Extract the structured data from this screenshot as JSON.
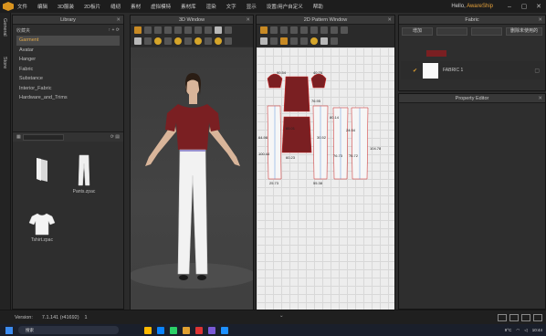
{
  "menu": {
    "items": [
      "文件",
      "编辑",
      "3D服装",
      "2D板片",
      "缝纫",
      "素材",
      "虚拟模特",
      "素材库",
      "渲染",
      "文字",
      "显示",
      "设置/用户自定义",
      "帮助"
    ],
    "greeting": "Hello, ",
    "username": "AwareShip"
  },
  "side_tabs": [
    "General",
    "Store"
  ],
  "library": {
    "title": "Library",
    "toolbar_label": "收藏夹",
    "items": [
      "Garment",
      "Avatar",
      "Hanger",
      "Fabric",
      "Substance",
      "Interior_Fabric",
      "Hardware_and_Trims"
    ],
    "selected_index": 0,
    "files": [
      "",
      "Pants.zpac",
      "Tshirt.zpac"
    ]
  },
  "window3d": {
    "title": "3D Window"
  },
  "window2d": {
    "title": "2D Pattern Window",
    "measurements": [
      "90.54",
      "40.76",
      "76.95",
      "80.14",
      "24.34",
      "64.98",
      "30.52",
      "76.73",
      "76.72",
      "104.78",
      "100.44",
      "65.01",
      "60.23",
      "25.73",
      "55.38"
    ]
  },
  "fabric": {
    "title": "Fabric",
    "buttons": [
      "增加",
      "",
      "",
      "删除未使用的"
    ],
    "item_name": "FABRIC 1"
  },
  "property_editor": {
    "title": "Property Editor"
  },
  "status": {
    "label": "Version:",
    "version": "7.1.141 (r41692)",
    "extra": "1"
  },
  "taskbar": {
    "search": "搜索",
    "weather": "9°C",
    "time": "10:44"
  },
  "colors": {
    "accent": "#e0a030",
    "shirt": "#7a1f22",
    "pattern_line": "#cc2222"
  }
}
